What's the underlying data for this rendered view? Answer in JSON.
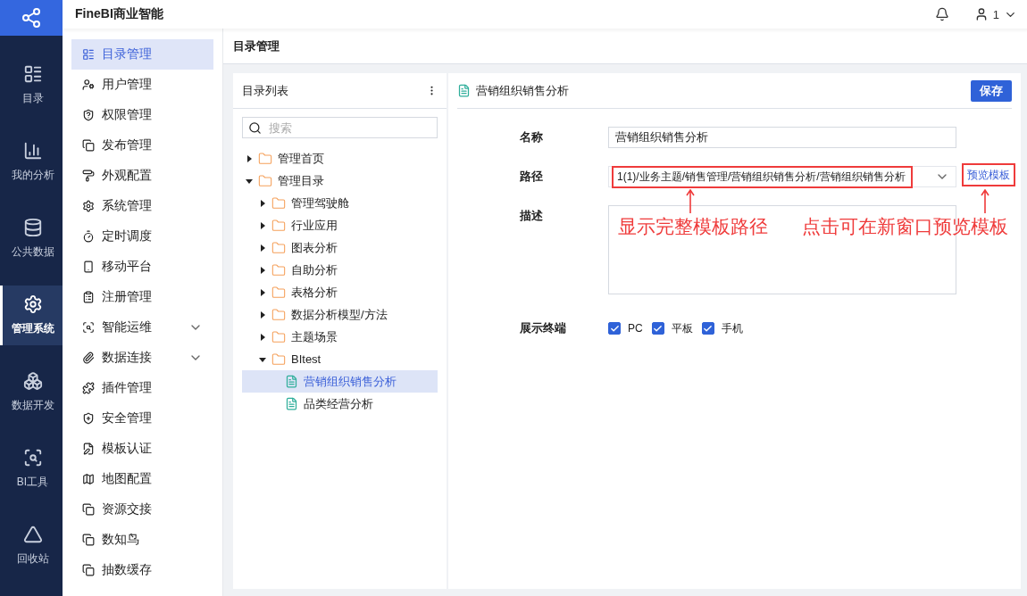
{
  "app": {
    "title": "FineBI商业智能",
    "user": "1"
  },
  "rail": [
    {
      "label": "目录",
      "selected": false
    },
    {
      "label": "我的分析",
      "selected": false
    },
    {
      "label": "公共数据",
      "selected": false
    },
    {
      "label": "管理系统",
      "selected": true
    },
    {
      "label": "数据开发",
      "selected": false
    },
    {
      "label": "BI工具",
      "selected": false
    },
    {
      "label": "回收站",
      "selected": false
    }
  ],
  "menu": [
    {
      "label": "目录管理",
      "selected": true,
      "submenu": false
    },
    {
      "label": "用户管理",
      "selected": false,
      "submenu": false
    },
    {
      "label": "权限管理",
      "selected": false,
      "submenu": false
    },
    {
      "label": "发布管理",
      "selected": false,
      "submenu": false
    },
    {
      "label": "外观配置",
      "selected": false,
      "submenu": false
    },
    {
      "label": "系统管理",
      "selected": false,
      "submenu": false
    },
    {
      "label": "定时调度",
      "selected": false,
      "submenu": false
    },
    {
      "label": "移动平台",
      "selected": false,
      "submenu": false
    },
    {
      "label": "注册管理",
      "selected": false,
      "submenu": false
    },
    {
      "label": "智能运维",
      "selected": false,
      "submenu": true
    },
    {
      "label": "数据连接",
      "selected": false,
      "submenu": true
    },
    {
      "label": "插件管理",
      "selected": false,
      "submenu": false
    },
    {
      "label": "安全管理",
      "selected": false,
      "submenu": false
    },
    {
      "label": "模板认证",
      "selected": false,
      "submenu": false
    },
    {
      "label": "地图配置",
      "selected": false,
      "submenu": false
    },
    {
      "label": "资源交接",
      "selected": false,
      "submenu": false
    },
    {
      "label": "数知鸟",
      "selected": false,
      "submenu": false
    },
    {
      "label": "抽数缓存",
      "selected": false,
      "submenu": false
    }
  ],
  "page_title": "目录管理",
  "tree_panel": {
    "title": "目录列表",
    "search_placeholder": "搜索",
    "nodes": [
      {
        "kind": "folder",
        "label": "管理首页",
        "expanded": false,
        "selected": false
      },
      {
        "kind": "folder",
        "label": "管理目录",
        "expanded": true,
        "selected": false,
        "children": [
          {
            "kind": "folder",
            "label": "管理驾驶舱",
            "expanded": false,
            "selected": false
          },
          {
            "kind": "folder",
            "label": "行业应用",
            "expanded": false,
            "selected": false
          },
          {
            "kind": "folder",
            "label": "图表分析",
            "expanded": false,
            "selected": false
          },
          {
            "kind": "folder",
            "label": "自助分析",
            "expanded": false,
            "selected": false
          },
          {
            "kind": "folder",
            "label": "表格分析",
            "expanded": false,
            "selected": false
          },
          {
            "kind": "folder",
            "label": "数据分析模型/方法",
            "expanded": false,
            "selected": false
          },
          {
            "kind": "folder",
            "label": "主题场景",
            "expanded": false,
            "selected": false
          },
          {
            "kind": "folder",
            "label": "BItest",
            "expanded": true,
            "selected": false,
            "children": [
              {
                "kind": "report",
                "label": "营销组织销售分析",
                "selected": true
              },
              {
                "kind": "report",
                "label": "品类经营分析",
                "selected": false
              }
            ]
          }
        ]
      }
    ]
  },
  "editor": {
    "title": "营销组织销售分析",
    "save_button": "保存",
    "name": {
      "label": "名称",
      "value": "营销组织销售分析"
    },
    "path": {
      "label": "路径",
      "value": "1(1)/业务主题/销售管理/营销组织销售分析/营销组织销售分析",
      "preview_link": "预览模板"
    },
    "description": {
      "label": "描述"
    },
    "terminals": {
      "label": "展示终端",
      "options": [
        {
          "label": "PC",
          "checked": true
        },
        {
          "label": "平板",
          "checked": true
        },
        {
          "label": "手机",
          "checked": true
        }
      ]
    }
  },
  "annotations": [
    {
      "text": "显示完整模板路径"
    },
    {
      "text": "点击可在新窗口预览模板"
    }
  ]
}
